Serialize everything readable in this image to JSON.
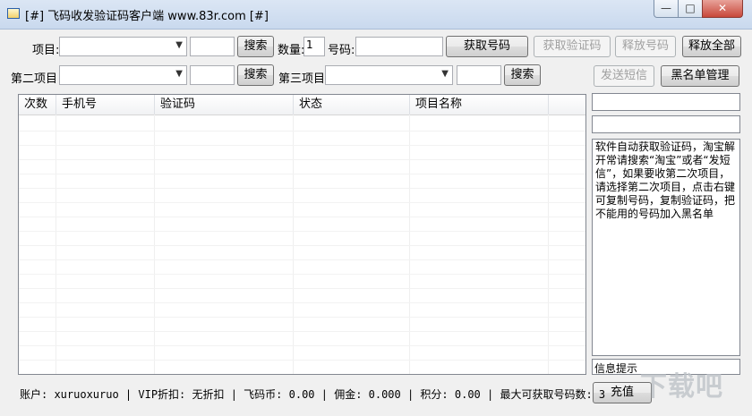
{
  "window": {
    "title": "[#] 飞码收发验证码客户端  www.83r.com [#]",
    "min_glyph": "—",
    "max_glyph": "□",
    "close_glyph": "✕"
  },
  "row1": {
    "project_label": "项目:",
    "search_label": "搜索",
    "quantity_label": "数量:",
    "quantity_value": "1",
    "number_label": "号码:",
    "get_number_label": "获取号码",
    "get_code_label": "获取验证码",
    "release_number_label": "释放号码",
    "release_all_label": "释放全部"
  },
  "row2": {
    "second_project_label": "第二项目",
    "search_label": "搜索",
    "third_project_label": "第三项目",
    "search3_label": "搜索",
    "send_sms_label": "发送短信",
    "blacklist_label": "黑名单管理"
  },
  "grid": {
    "columns": [
      "次数",
      "手机号",
      "验证码",
      "状态",
      "项目名称"
    ]
  },
  "notice_text": "软件自动获取验证码，淘宝解开常请搜索“淘宝”或者“发短信”，如果要收第二次项目，请选择第二次项目，点击右键可复制号码，复制验证码，把不能用的号码加入黑名单",
  "info_label": "信息提示",
  "recharge_label": "充值",
  "status_bar": "账户: xuruoxuruo | VIP折扣: 无折扣 | 飞码币: 0.00 | 佣金: 0.000 | 积分: 0.00 | 最大可获取号码数: 3",
  "watermark_text": "下载吧",
  "icons": {
    "dropdown": "▼"
  }
}
